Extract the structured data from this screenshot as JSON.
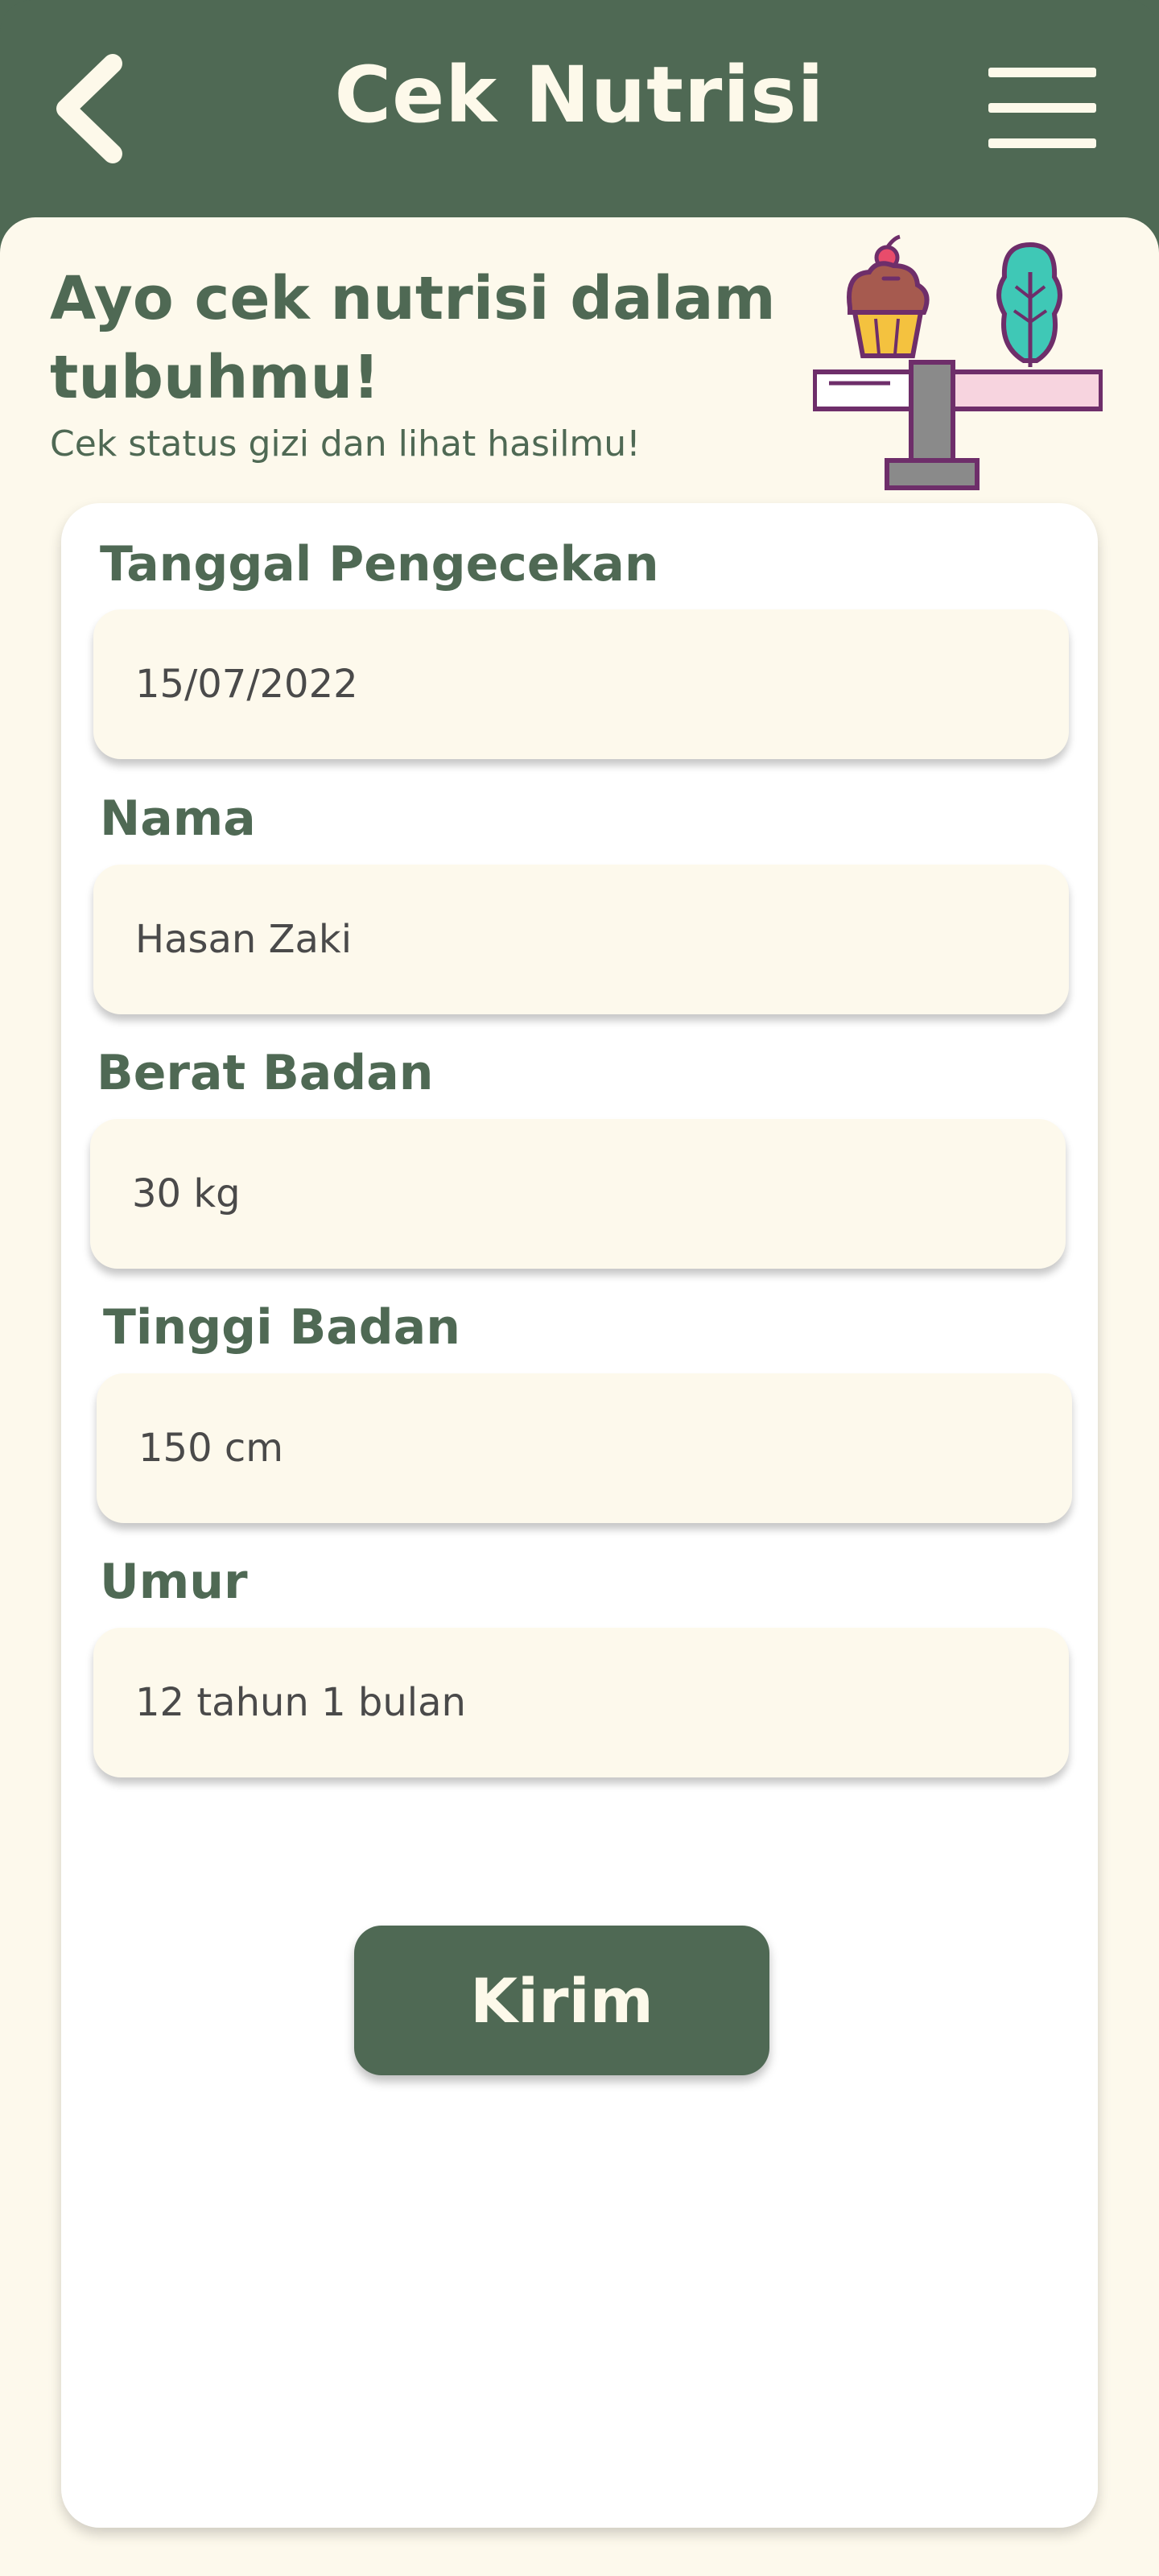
{
  "header": {
    "title": "Cek Nutrisi"
  },
  "hero": {
    "title": "Ayo cek nutrisi dalam tubuhmu!",
    "subtitle": "Cek status gizi dan lihat hasilmu!"
  },
  "form": {
    "fields": [
      {
        "label": "Tanggal Pengecekan",
        "value": "15/07/2022"
      },
      {
        "label": "Nama",
        "value": "Hasan Zaki"
      },
      {
        "label": "Berat Badan",
        "value": "30 kg"
      },
      {
        "label": "Tinggi Badan",
        "value": "150 cm"
      },
      {
        "label": "Umur",
        "value": "12 tahun 1 bulan"
      }
    ],
    "submit_label": "Kirim"
  },
  "colors": {
    "primary": "#4f6954",
    "surface": "#fdf9ec",
    "card": "#ffffff",
    "text_input": "#4a4a4a"
  },
  "icons": {
    "back": "chevron-left-icon",
    "menu": "hamburger-menu-icon",
    "illustration": "nutrition-scale-icon"
  }
}
